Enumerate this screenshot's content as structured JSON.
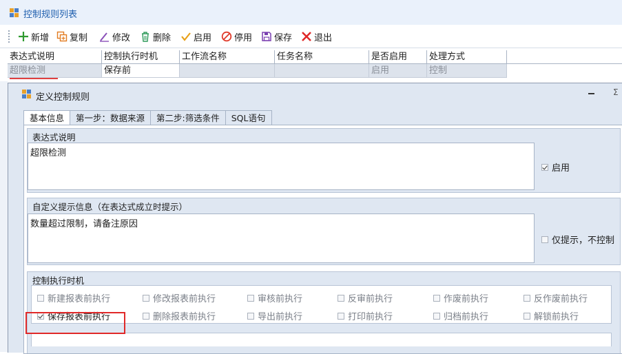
{
  "window": {
    "title": "控制规则列表"
  },
  "toolbar": {
    "new": "新增",
    "copy": "复制",
    "edit": "修改",
    "delete": "删除",
    "enable": "启用",
    "disable": "停用",
    "save": "保存",
    "exit": "退出"
  },
  "grid": {
    "columns": [
      "表达式说明",
      "控制执行时机",
      "工作流名称",
      "任务名称",
      "是否启用",
      "处理方式"
    ],
    "row": [
      "超限检测",
      "保存前",
      "",
      "",
      "启用",
      "控制"
    ]
  },
  "dialog": {
    "title": "定义控制规则",
    "tabs": [
      "基本信息",
      "第一步：数据来源",
      "第二步:筛选条件",
      "SQL语句"
    ],
    "expression": {
      "header": "表达式说明",
      "value": "超限检测",
      "enabled_label": "启用",
      "enabled": true
    },
    "prompt": {
      "header": "自定义提示信息（在表达式成立时提示）",
      "value": "数量超过限制，请备注原因",
      "only_prompt_label": "仅提示，不控制",
      "only_prompt": false
    },
    "timing": {
      "header": "控制执行时机",
      "row1": [
        "新建报表前执行",
        "修改报表前执行",
        "审核前执行",
        "反审前执行",
        "作废前执行",
        "反作废前执行"
      ],
      "row2": [
        "保存报表前执行",
        "删除报表前执行",
        "导出前执行",
        "打印前执行",
        "归档前执行",
        "解锁前执行"
      ],
      "checked": [
        "保存报表前执行"
      ]
    }
  },
  "colors": {
    "accent": "#1f5fae",
    "highlight": "#e02828",
    "panel_bg": "#dfe7f2"
  }
}
